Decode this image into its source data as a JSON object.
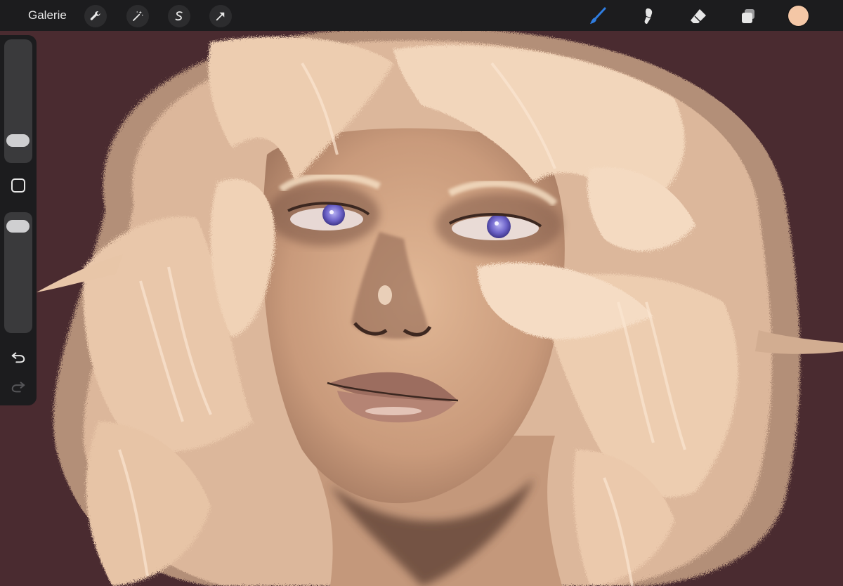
{
  "toolbar": {
    "gallery_label": "Galerie",
    "left_tools": [
      {
        "name": "wrench-icon",
        "action": "actions"
      },
      {
        "name": "magic-wand-icon",
        "action": "adjustments"
      },
      {
        "name": "selection-icon",
        "action": "selection"
      },
      {
        "name": "transform-arrow-icon",
        "action": "transform"
      }
    ],
    "right_tools": [
      {
        "name": "brush-icon",
        "active": true,
        "color": "#2f7de1"
      },
      {
        "name": "smudge-icon",
        "active": false,
        "color": "#e6e6e6"
      },
      {
        "name": "eraser-icon",
        "active": false,
        "color": "#e6e6e6"
      },
      {
        "name": "layers-icon",
        "active": false,
        "color": "#e6e6e6"
      }
    ],
    "current_color": "#f4c7a6"
  },
  "sidebar": {
    "brush_size_level": 0.13,
    "opacity_level": 0.95,
    "modify_button_icon": "square-icon",
    "undo_icon": "undo-icon",
    "redo_icon": "redo-icon"
  },
  "canvas": {
    "background_color": "#4a2b30",
    "artwork": "portrait-painting"
  }
}
